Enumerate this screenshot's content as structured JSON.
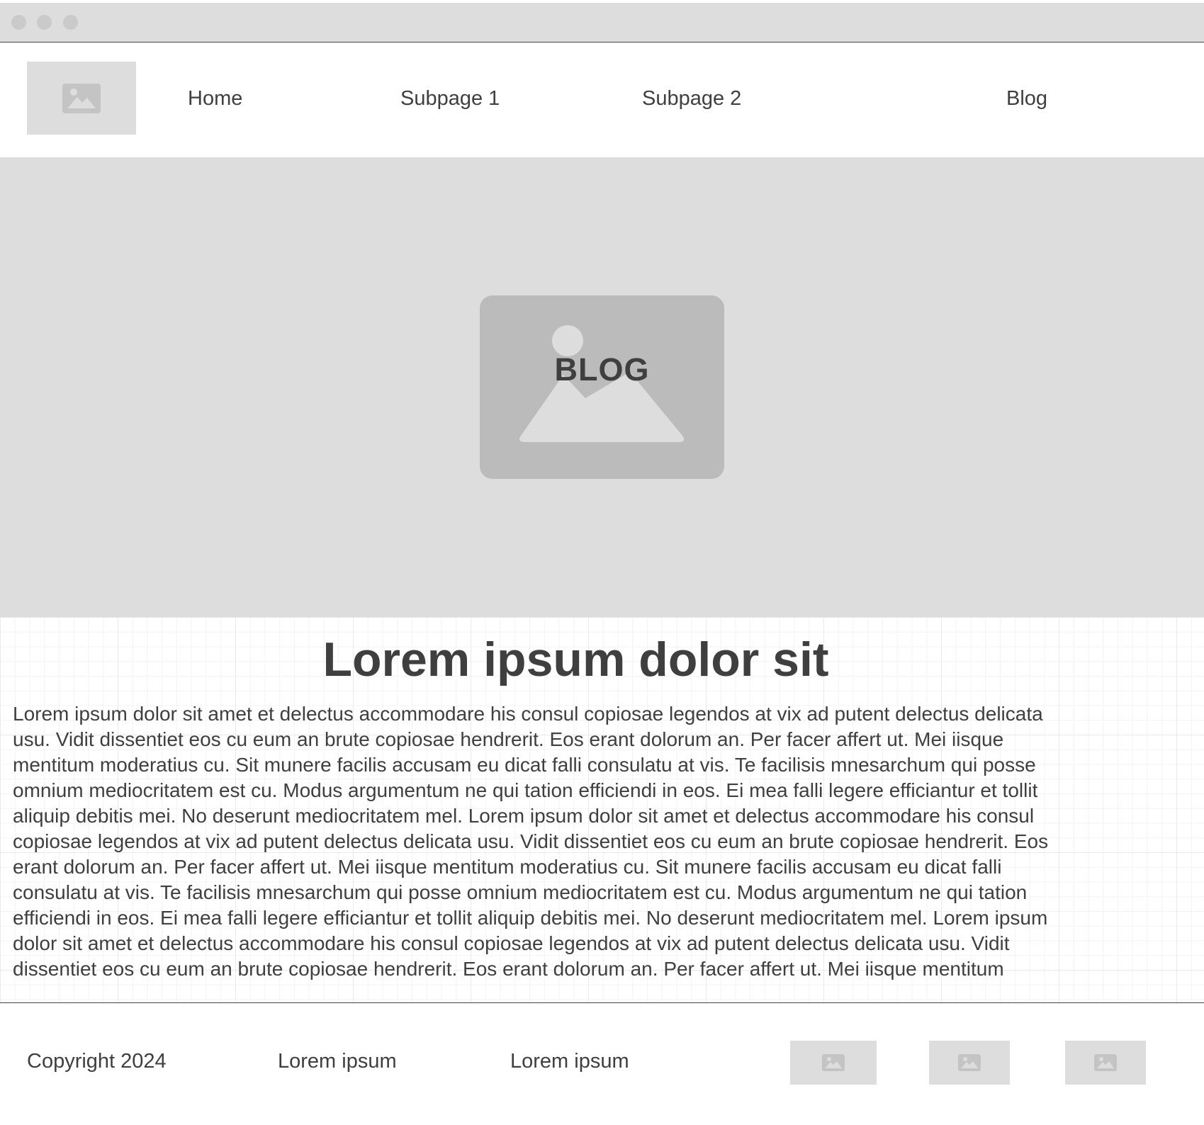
{
  "window": {
    "controls": [
      "close-dot",
      "minimize-dot",
      "maximize-dot"
    ]
  },
  "header": {
    "logo_icon": "image-placeholder-icon",
    "nav": {
      "home": "Home",
      "subpage1": "Subpage 1",
      "subpage2": "Subpage 2",
      "blog": "Blog"
    }
  },
  "hero": {
    "icon": "image-placeholder-icon",
    "title": "BLOG"
  },
  "main": {
    "heading": "Lorem ipsum dolor sit",
    "lines": [
      "Lorem ipsum dolor sit amet et delectus accommodare his consul copiosae legendos at vix ad putent delectus delicata",
      "usu. Vidit dissentiet eos cu eum an brute copiosae hendrerit. Eos erant dolorum an. Per facer affert ut. Mei iisque",
      "mentitum moderatius cu. Sit munere facilis accusam eu dicat falli consulatu at vis. Te facilisis mnesarchum qui posse",
      "omnium mediocritatem est cu. Modus argumentum ne qui tation efficiendi in eos. Ei mea falli legere efficiantur et tollit",
      "aliquip debitis mei. No deserunt mediocritatem mel. Lorem ipsum dolor sit amet et delectus accommodare his consul",
      "copiosae legendos at vix ad putent delectus delicata usu. Vidit dissentiet eos cu eum an brute copiosae hendrerit. Eos",
      "erant dolorum an. Per facer affert ut. Mei iisque mentitum moderatius cu. Sit munere facilis accusam eu dicat falli",
      "consulatu at vis. Te facilisis mnesarchum qui posse omnium mediocritatem est cu. Modus argumentum ne qui tation",
      "efficiendi in eos. Ei mea falli legere efficiantur et tollit aliquip debitis mei. No deserunt mediocritatem mel. Lorem ipsum",
      "dolor sit amet et delectus accommodare his consul copiosae legendos at vix ad putent delectus delicata usu. Vidit",
      "dissentiet eos cu eum an brute copiosae hendrerit. Eos erant dolorum an. Per facer affert ut. Mei iisque mentitum"
    ]
  },
  "footer": {
    "copyright": "Copyright 2024",
    "link1": "Lorem ipsum",
    "link2": "Lorem ipsum",
    "icons": [
      "image-placeholder-icon",
      "image-placeholder-icon",
      "image-placeholder-icon"
    ]
  },
  "colors": {
    "chrome": "#dddddd",
    "placeholder": "#dddddd",
    "hero_image": "#bbbbbb",
    "text": "#3f3f3f"
  }
}
